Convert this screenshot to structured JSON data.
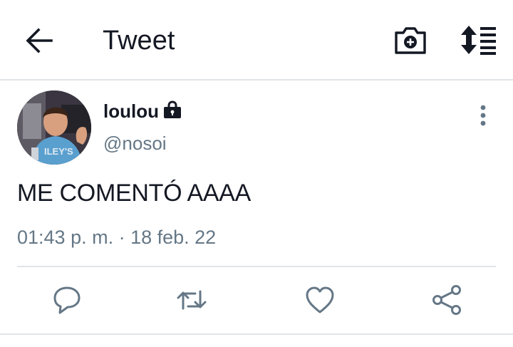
{
  "header": {
    "title": "Tweet",
    "icons": [
      "arrow-left-icon",
      "camera-plus-icon",
      "sort-lines-icon"
    ]
  },
  "tweet": {
    "author_name": "loulou",
    "author_handle": "@nosoi",
    "text": "ME COMENTÓ AAAA",
    "timestamp": "01:43 p. m. · 18 feb. 22",
    "actions": [
      "reply",
      "retweet",
      "like",
      "share"
    ]
  },
  "colors": {
    "text_primary": "#141823",
    "text_secondary": "#657786",
    "divider": "#e1e5e8",
    "icon": "#657786"
  }
}
